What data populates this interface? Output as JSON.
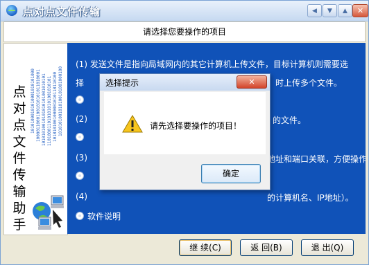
{
  "window": {
    "title": "点对点文件传输",
    "header": "请选择您要操作的项目"
  },
  "left": {
    "binary_lines": [
      "10101000101010001010101000",
      "10000110001001010101011010001",
      "10101010010101010101001010101",
      "1101000110101010101001010101",
      "1010101001000001010110110100",
      "1010101001010100101001000100"
    ],
    "vertical_title": [
      "点",
      "对",
      "点",
      "文",
      "件",
      "传",
      "输",
      "助",
      "手"
    ]
  },
  "options": {
    "line1": "(1) 发送文件是指向局域网内的其它计算机上传文件，目标计算机则需要选",
    "line2_left": "择",
    "line2_right": "时上传多个文件。",
    "line3_right": "的文件。",
    "line4_right": "地址和端口关联，方便操作。",
    "line5_right": "的计算机名、IP地址）。",
    "opt2_prefix": "(2)",
    "opt3_prefix": "(3)",
    "opt4_prefix": "(4)",
    "help_label": "软件说明"
  },
  "buttons": {
    "continue": "继 续(C)",
    "back": "返 回(B)",
    "exit": "退 出(Q)"
  },
  "dialog": {
    "title": "选择提示",
    "message": "请先选择要操作的项目！",
    "ok": "确定",
    "close": "✕"
  }
}
